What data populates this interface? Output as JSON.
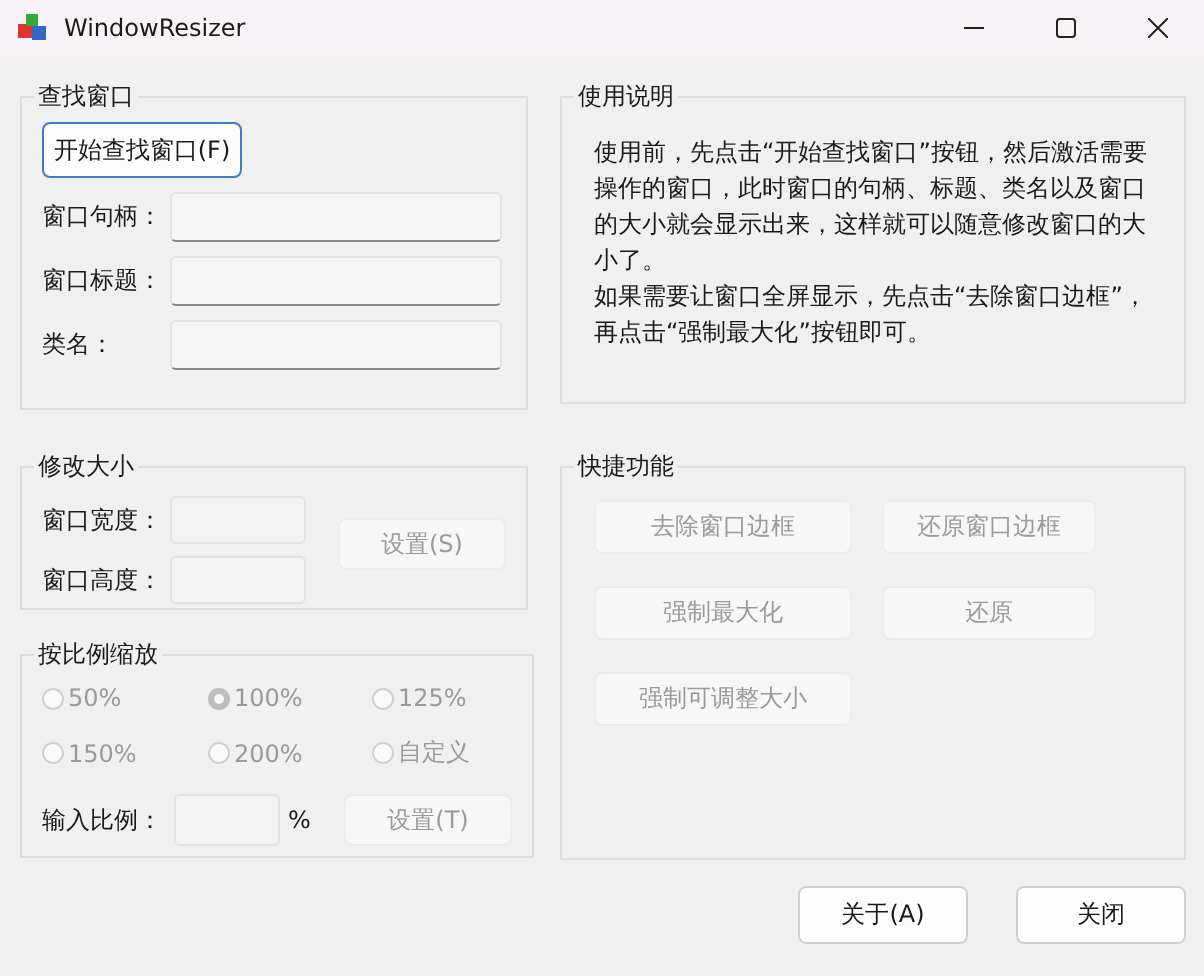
{
  "window": {
    "title": "WindowResizer"
  },
  "find_group": {
    "title": "查找窗口",
    "button": {
      "label": "开始查找窗口(F)",
      "disabled": false
    },
    "fields": [
      {
        "label": "窗口句柄："
      },
      {
        "label": "窗口标题："
      },
      {
        "label": "类名："
      }
    ]
  },
  "resize_group": {
    "title": "修改大小",
    "fields": [
      {
        "label": "窗口宽度：",
        "disabled": true
      },
      {
        "label": "窗口高度：",
        "disabled": true
      }
    ],
    "button": {
      "label": "设置(S)",
      "disabled": true
    }
  },
  "scale_group": {
    "title": "按比例缩放",
    "options": [
      {
        "label": "50%",
        "selected": false,
        "disabled": true
      },
      {
        "label": "100%",
        "selected": true,
        "disabled": true
      },
      {
        "label": "125%",
        "selected": false,
        "disabled": true
      },
      {
        "label": "150%",
        "selected": false,
        "disabled": true
      },
      {
        "label": "200%",
        "selected": false,
        "disabled": true
      },
      {
        "label": "自定义",
        "selected": false,
        "disabled": true
      }
    ],
    "input_label": "输入比例：",
    "unit": "%",
    "input_disabled": true,
    "button": {
      "label": "设置(T)",
      "disabled": true
    }
  },
  "help_group": {
    "title": "使用说明",
    "paragraphs": [
      "使用前，先点击“开始查找窗口”按钮，然后激活需要操作的窗口，此时窗口的句柄、标题、类名以及窗口的大小就会显示出来，这样就可以随意修改窗口的大小了。",
      "如果需要让窗口全屏显示，先点击“去除窗口边框”，再点击“强制最大化”按钮即可。"
    ]
  },
  "quick_group": {
    "title": "快捷功能",
    "buttons": [
      {
        "label": "去除窗口边框",
        "disabled": true
      },
      {
        "label": "还原窗口边框",
        "disabled": true
      },
      {
        "label": "强制最大化",
        "disabled": true
      },
      {
        "label": "还原",
        "disabled": true
      },
      {
        "label": "强制可调整大小",
        "disabled": true
      }
    ]
  },
  "footer_buttons": [
    {
      "label": "关于(A)",
      "disabled": false
    },
    {
      "label": "关闭",
      "disabled": false
    }
  ]
}
